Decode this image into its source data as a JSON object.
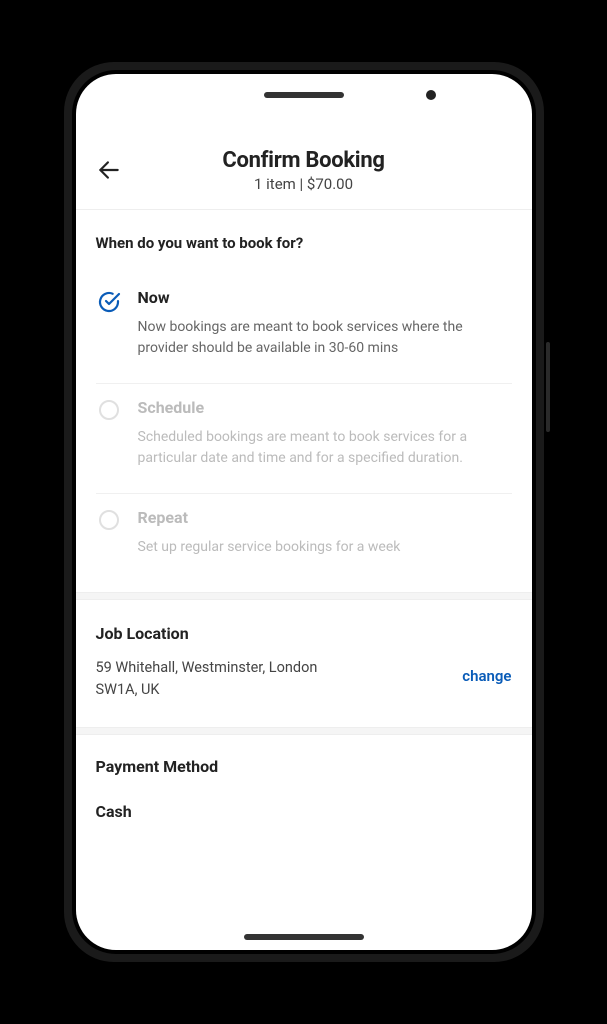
{
  "header": {
    "title": "Confirm Booking",
    "subtitle": "1 item | $70.00"
  },
  "booking_time": {
    "question": "When do you want to book for?",
    "options": [
      {
        "label": "Now",
        "description": "Now bookings are meant to book services where the provider should be available in 30-60 mins",
        "selected": true
      },
      {
        "label": "Schedule",
        "description": "Scheduled bookings are meant to book services for a particular date and time and for a specified duration.",
        "selected": false
      },
      {
        "label": "Repeat",
        "description": "Set up regular service bookings for a week",
        "selected": false
      }
    ]
  },
  "location": {
    "title": "Job Location",
    "address_line1": "59 Whitehall, Westminster, London",
    "address_line2": "SW1A, UK",
    "change_label": "change"
  },
  "payment": {
    "title": "Payment Method",
    "value": "Cash"
  }
}
